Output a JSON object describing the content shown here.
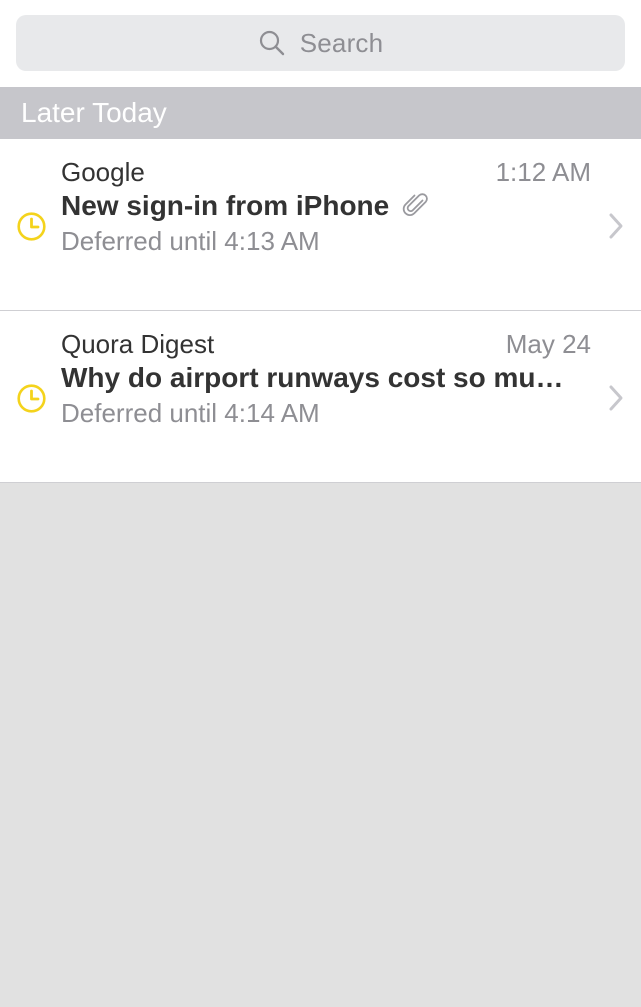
{
  "search": {
    "placeholder": "Search",
    "icon": "magnifier"
  },
  "section": {
    "title": "Later Today"
  },
  "colors": {
    "accent_yellow": "#f4d31c",
    "secondary_text": "#8e8e93",
    "primary_text": "#333333",
    "section_bg": "#c6c6cb",
    "empty_bg": "#e1e1e1"
  },
  "messages": [
    {
      "sender": "Google",
      "date": "1:12 AM",
      "subject": "New sign-in from iPhone",
      "has_attachment": true,
      "status": "Deferred until 4:13 AM",
      "status_icon": "clock"
    },
    {
      "sender": "Quora Digest",
      "date": "May 24",
      "subject": "Why do airport runways cost so mu…",
      "has_attachment": false,
      "status": "Deferred until 4:14 AM",
      "status_icon": "clock"
    }
  ]
}
